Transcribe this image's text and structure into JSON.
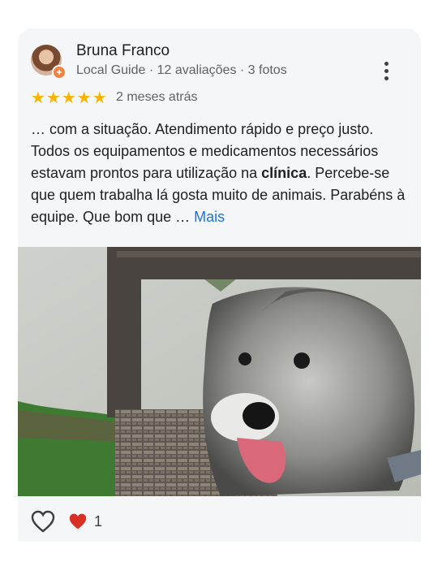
{
  "review": {
    "author": "Bruna Franco",
    "author_meta": "Local Guide · 12 avaliações · 3 fotos",
    "stars": "★★★★★",
    "rating": 5,
    "time_ago": "2 meses atrás",
    "text_part1": "… com a situação. Atendimento rápido e preço justo. Todos os equipamentos e medicamentos necessários estavam prontos para utilização na ",
    "text_bold": "clínica",
    "text_part2": ". Percebe-se que quem trabalha lá gosta muito de animais. Parabéns à equipe. Que bom que … ",
    "more_label": "Mais"
  },
  "reactions": {
    "like_count": "1"
  },
  "colors": {
    "star": "#f9b400",
    "link": "#1a73e8",
    "heart": "#d93025",
    "card_bg": "#f4f6f8"
  }
}
